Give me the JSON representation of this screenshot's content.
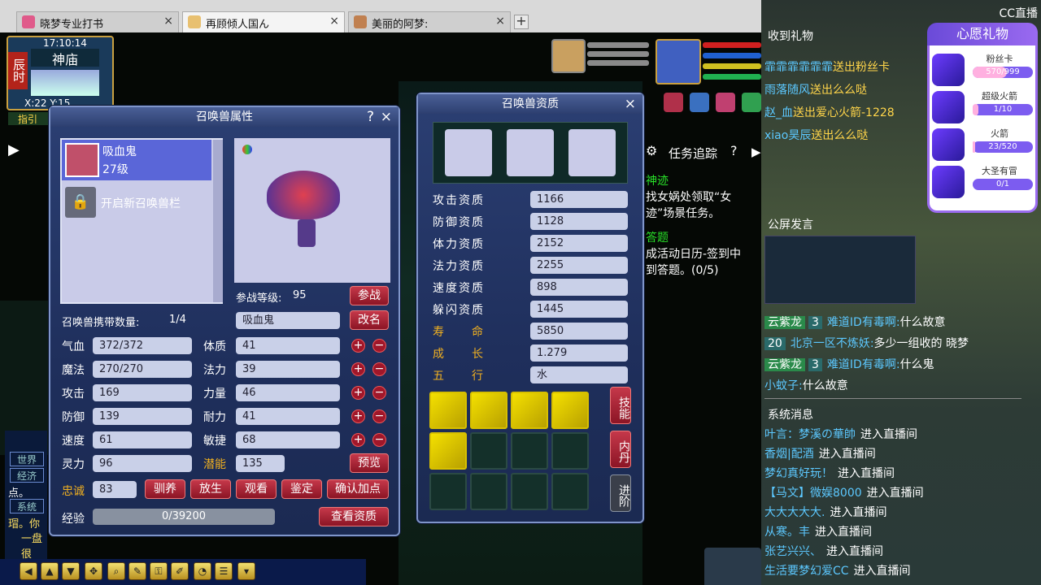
{
  "browser": {
    "tabs": [
      {
        "label": "晓梦专业打书",
        "active": false
      },
      {
        "label": "再顾倾人国ん",
        "active": true
      },
      {
        "label": "美丽的阿梦:",
        "active": false
      }
    ],
    "close": "×",
    "new_tab": "+"
  },
  "hud": {
    "time": "17:10:14",
    "location": "神庙",
    "shichen": "辰时",
    "coords": "X:22  Y:15",
    "guide": "指引"
  },
  "task": {
    "title": "任务追踪",
    "help": "?",
    "lines": [
      {
        "text": "神迹",
        "color": "#28e028"
      },
      {
        "text": "找女娲处领取“女",
        "color": "#ffffff"
      },
      {
        "text": "迹”场景任务。",
        "color": "#ffffff"
      },
      {
        "text": "答题",
        "color": "#28e028"
      },
      {
        "text": "成活动日历-签到中",
        "color": "#ffffff"
      },
      {
        "text": "到答题。(0/5)",
        "color": "#ffffff"
      }
    ]
  },
  "pet_attr": {
    "title": "召唤兽属性",
    "help": "?",
    "close": "×",
    "pet_name": "吸血鬼",
    "pet_level": "27级",
    "unlock_slot": "开启新召唤兽栏",
    "battle_level_label": "参战等级:",
    "battle_level": "95",
    "battle_btn": "参战",
    "carry_label": "召唤兽携带数量:",
    "carry_value": "1/4",
    "name_field": "吸血鬼",
    "rename_btn": "改名",
    "stats_left": [
      {
        "label": "气血",
        "value": "372/372"
      },
      {
        "label": "魔法",
        "value": "270/270"
      },
      {
        "label": "攻击",
        "value": "169"
      },
      {
        "label": "防御",
        "value": "139"
      },
      {
        "label": "速度",
        "value": "61"
      },
      {
        "label": "灵力",
        "value": "96"
      }
    ],
    "stats_right": [
      {
        "label": "体质",
        "value": "41"
      },
      {
        "label": "法力",
        "value": "39"
      },
      {
        "label": "力量",
        "value": "46"
      },
      {
        "label": "耐力",
        "value": "41"
      },
      {
        "label": "敏捷",
        "value": "68"
      },
      {
        "label": "潜能",
        "value": "135"
      }
    ],
    "plus": "+",
    "minus": "−",
    "preview_btn": "预览",
    "loyalty_label": "忠诚",
    "loyalty_value": "83",
    "action_btns": [
      "驯养",
      "放生",
      "观看",
      "鉴定",
      "确认加点"
    ],
    "exp_label": "经验",
    "exp_value": "0/39200",
    "exp_progress": 0,
    "view_btn": "查看资质"
  },
  "pet_apt": {
    "title": "召唤兽资质",
    "close": "×",
    "rows": [
      {
        "label": "攻击资质",
        "value": "1166",
        "gold": false
      },
      {
        "label": "防御资质",
        "value": "1128",
        "gold": false
      },
      {
        "label": "体力资质",
        "value": "2152",
        "gold": false
      },
      {
        "label": "法力资质",
        "value": "2255",
        "gold": false
      },
      {
        "label": "速度资质",
        "value": "898",
        "gold": false
      },
      {
        "label": "躲闪资质",
        "value": "1445",
        "gold": false
      },
      {
        "label": "寿　　命",
        "value": "5850",
        "gold": true
      },
      {
        "label": "成　　长",
        "value": "1.279",
        "gold": true
      },
      {
        "label": "五　　行",
        "value": "水",
        "gold": true
      }
    ],
    "tabs": [
      "技能",
      "内丹",
      "进阶"
    ]
  },
  "stream": {
    "gifts_title": "收到礼物",
    "gift_msgs": [
      {
        "name": "霏霏霏霏霏霏",
        "text": "送出粉丝卡"
      },
      {
        "name": "雨落随风",
        "text": "送出么么哒"
      },
      {
        "name": "赵_血",
        "text": "送出爱心火箭-1228"
      },
      {
        "name": "xiao昊辰",
        "text": "送出么么哒"
      }
    ],
    "wish_title": "心愿礼物",
    "wish_items": [
      {
        "name": "粉丝卡",
        "progress": "570/999",
        "ratio": 0.57
      },
      {
        "name": "超级火箭",
        "progress": "1/10",
        "ratio": 0.1
      },
      {
        "name": "火箭",
        "progress": "23/520",
        "ratio": 0.044
      },
      {
        "name": "大圣有冒",
        "progress": "0/1",
        "ratio": 0
      }
    ],
    "public_title": "公屏发言",
    "chat": [
      {
        "badge": "云紫龙",
        "lvl": "3",
        "name": "难道ID有毒啊:",
        "text": "什么故意"
      },
      {
        "badge": "",
        "lvl": "20",
        "name": "北京一区不炼妖:",
        "text": "多少一组收的 晓梦"
      },
      {
        "badge": "云紫龙",
        "lvl": "3",
        "name": "难道ID有毒啊:",
        "text": "什么鬼"
      },
      {
        "badge": "",
        "lvl": "",
        "name": "小蚊子:",
        "text": "什么故意"
      }
    ],
    "sys_title": "系统消息",
    "sys": [
      {
        "name": "叶言：梦溪の華帥",
        "text": "进入直播间"
      },
      {
        "name": "香烟|配酒",
        "text": "进入直播间"
      },
      {
        "name": "梦幻真好玩！",
        "text": "进入直播间"
      },
      {
        "name": "【马文】微娱8000",
        "text": "进入直播间"
      },
      {
        "name": "大大大大大.",
        "text": "进入直播间"
      },
      {
        "name": "从寒。丰",
        "text": "进入直播间"
      },
      {
        "name": "张艺兴兴、",
        "text": "进入直播间"
      },
      {
        "name": "生活要梦幻爱CC",
        "text": "进入直播间"
      }
    ],
    "logo": "CC直播"
  },
  "left_chat": {
    "tabs": [
      "世界",
      "经济",
      "系统"
    ],
    "lines": [
      "点。",
      "瑁。你",
      "一盘很"
    ]
  }
}
